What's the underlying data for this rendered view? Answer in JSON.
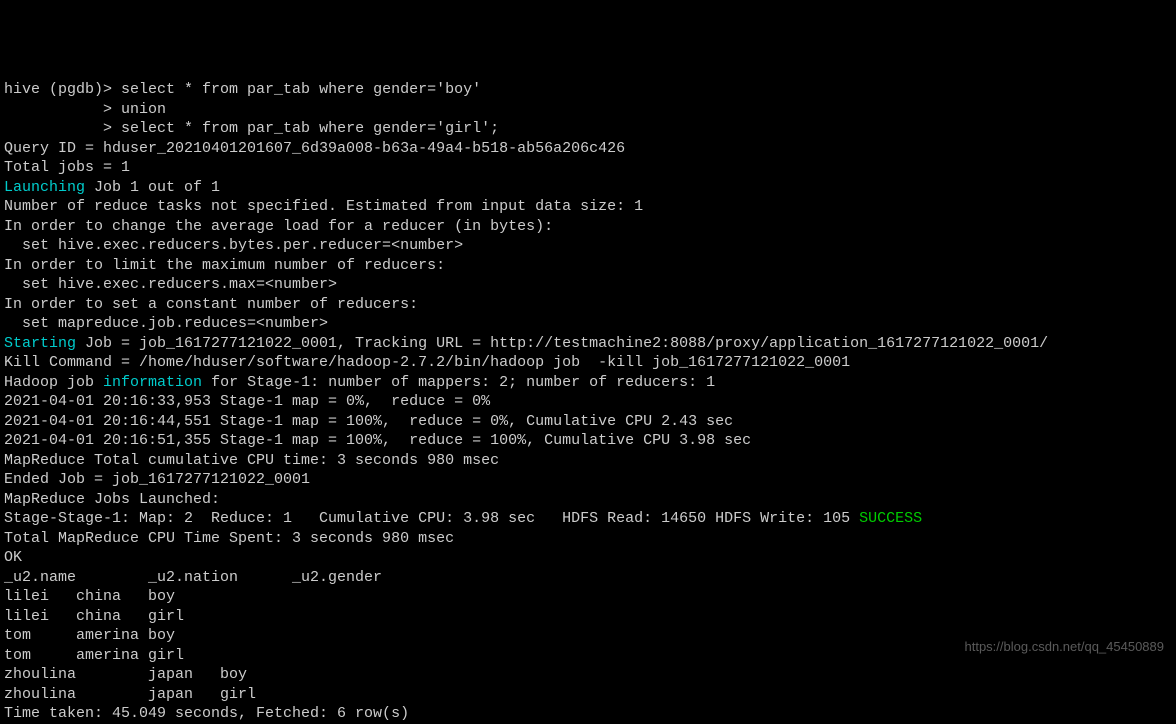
{
  "prompt": {
    "line1_prefix": "hive (pgdb)> ",
    "line1_cmd": "select * from par_tab where gender='boy'",
    "line2_prefix": "           > ",
    "line2_cmd": "union",
    "line3_prefix": "           > ",
    "line3_cmd": "select * from par_tab where gender='girl';"
  },
  "lines": {
    "query_id": "Query ID = hduser_20210401201607_6d39a008-b63a-49a4-b518-ab56a206c426",
    "total_jobs": "Total jobs = 1",
    "launching_word": "Launching",
    "launching_rest": " Job 1 out of 1",
    "reduce_tasks": "Number of reduce tasks not specified. Estimated from input data size: 1",
    "avg_load": "In order to change the average load for a reducer (in bytes):",
    "set_bytes": "  set hive.exec.reducers.bytes.per.reducer=<number>",
    "limit_max": "In order to limit the maximum number of reducers:",
    "set_max": "  set hive.exec.reducers.max=<number>",
    "constant_num": "In order to set a constant number of reducers:",
    "set_mapreduce": "  set mapreduce.job.reduces=<number>",
    "starting_word": "Starting",
    "starting_rest": " Job = job_1617277121022_0001, Tracking URL = http://testmachine2:8088/proxy/application_1617277121022_0001/",
    "kill_cmd": "Kill Command = /home/hduser/software/hadoop-2.7.2/bin/hadoop job  -kill job_1617277121022_0001",
    "hadoop_pre": "Hadoop job ",
    "hadoop_info_word": "information",
    "hadoop_post": " for Stage-1: number of mappers: 2; number of reducers: 1",
    "progress1": "2021-04-01 20:16:33,953 Stage-1 map = 0%,  reduce = 0%",
    "progress2": "2021-04-01 20:16:44,551 Stage-1 map = 100%,  reduce = 0%, Cumulative CPU 2.43 sec",
    "progress3": "2021-04-01 20:16:51,355 Stage-1 map = 100%,  reduce = 100%, Cumulative CPU 3.98 sec",
    "total_cpu": "MapReduce Total cumulative CPU time: 3 seconds 980 msec",
    "ended_job": "Ended Job = job_1617277121022_0001",
    "jobs_launched": "MapReduce Jobs Launched:",
    "stage_summary_pre": "Stage-Stage-1: Map: 2  Reduce: 1   Cumulative CPU: 3.98 sec   HDFS Read: 14650 HDFS Write: 105 ",
    "stage_summary_success": "SUCCESS",
    "total_spent": "Total MapReduce CPU Time Spent: 3 seconds 980 msec",
    "ok": "OK",
    "header": "_u2.name        _u2.nation      _u2.gender",
    "row1": "lilei   china   boy",
    "row2": "lilei   china   girl",
    "row3": "tom     amerina boy",
    "row4": "tom     amerina girl",
    "row5": "zhoulina        japan   boy",
    "row6": "zhoulina        japan   girl",
    "time_taken": "Time taken: 45.049 seconds, Fetched: 6 row(s)"
  },
  "watermark": "https://blog.csdn.net/qq_45450889"
}
